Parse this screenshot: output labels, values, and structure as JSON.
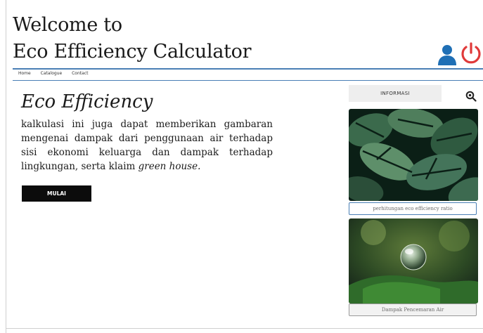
{
  "header": {
    "title_line1": "Welcome to",
    "title_line2": "Eco Efficiency Calculator",
    "user_icon": "user-icon",
    "power_icon": "power-icon",
    "power_color": "#e03a3a",
    "user_color": "#1f6fb5"
  },
  "nav": {
    "items": [
      "Home",
      "Catalogue",
      "Contact"
    ]
  },
  "hero": {
    "title": "Eco Efficiency",
    "text": "kalkulasi ini juga dapat memberikan gambaran mengenai dampak dari penggunaan air terhadap sisi ekonomi keluarga dan dampak terhadap lingkungan, serta klaim",
    "text_emphasis": "green house.",
    "button_label": "MULAI"
  },
  "sidebar": {
    "info_label": "INFORMASI",
    "search_icon": "search-icon",
    "cards": [
      {
        "label": "perhitungan eco efficiency ratio",
        "image": "monstera-leaves-image"
      },
      {
        "label": "Dampak Pencemaran Air",
        "image": "glass-globe-forest-image"
      }
    ]
  }
}
